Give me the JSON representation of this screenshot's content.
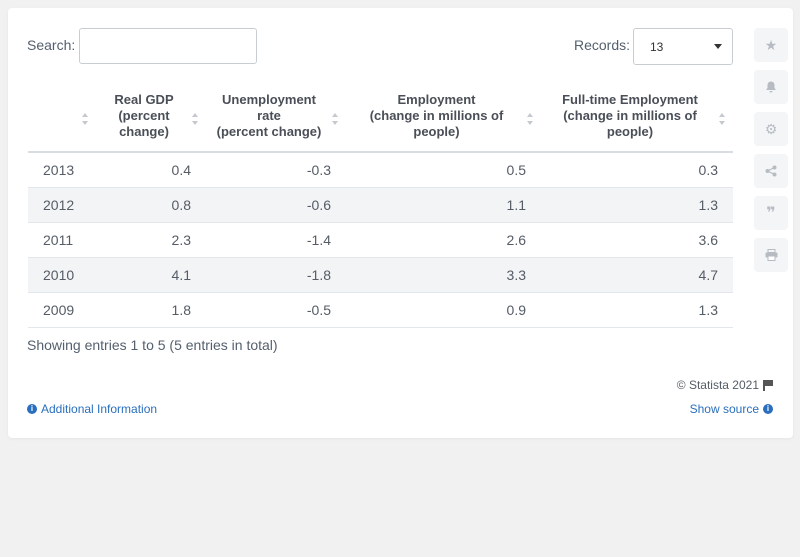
{
  "search": {
    "label": "Search:",
    "value": ""
  },
  "records": {
    "label": "Records:",
    "value": "13"
  },
  "chart_data": {
    "type": "table",
    "columns": [
      "",
      "Real GDP (percent change)",
      "Unemployment rate (percent change)",
      "Employment (change in millions of people)",
      "Full-time Employment (change in millions of people)"
    ],
    "header_lines": [
      [
        ""
      ],
      [
        "Real GDP",
        "(percent",
        "change)"
      ],
      [
        "Unemployment",
        "rate",
        "(percent change)"
      ],
      [
        "Employment",
        "(change in millions of",
        "people)"
      ],
      [
        "Full-time Employment",
        "(change in millions of",
        "people)"
      ]
    ],
    "rows": [
      [
        "2013",
        "0.4",
        "-0.3",
        "0.5",
        "0.3"
      ],
      [
        "2012",
        "0.8",
        "-0.6",
        "1.1",
        "1.3"
      ],
      [
        "2011",
        "2.3",
        "-1.4",
        "2.6",
        "3.6"
      ],
      [
        "2010",
        "4.1",
        "-1.8",
        "3.3",
        "4.7"
      ],
      [
        "2009",
        "1.8",
        "-0.5",
        "0.9",
        "1.3"
      ]
    ]
  },
  "footer": {
    "showing": "Showing entries 1 to 5 (5 entries in total)",
    "copyright": "© Statista 2021",
    "additional_info": "Additional Information",
    "show_source": "Show source"
  },
  "sidebar": {
    "icons": [
      "star-icon",
      "bell-icon",
      "gear-icon",
      "share-icon",
      "quote-icon",
      "print-icon"
    ]
  },
  "colors": {
    "link": "#2a6fbd",
    "row_alt": "#f3f4f6"
  }
}
